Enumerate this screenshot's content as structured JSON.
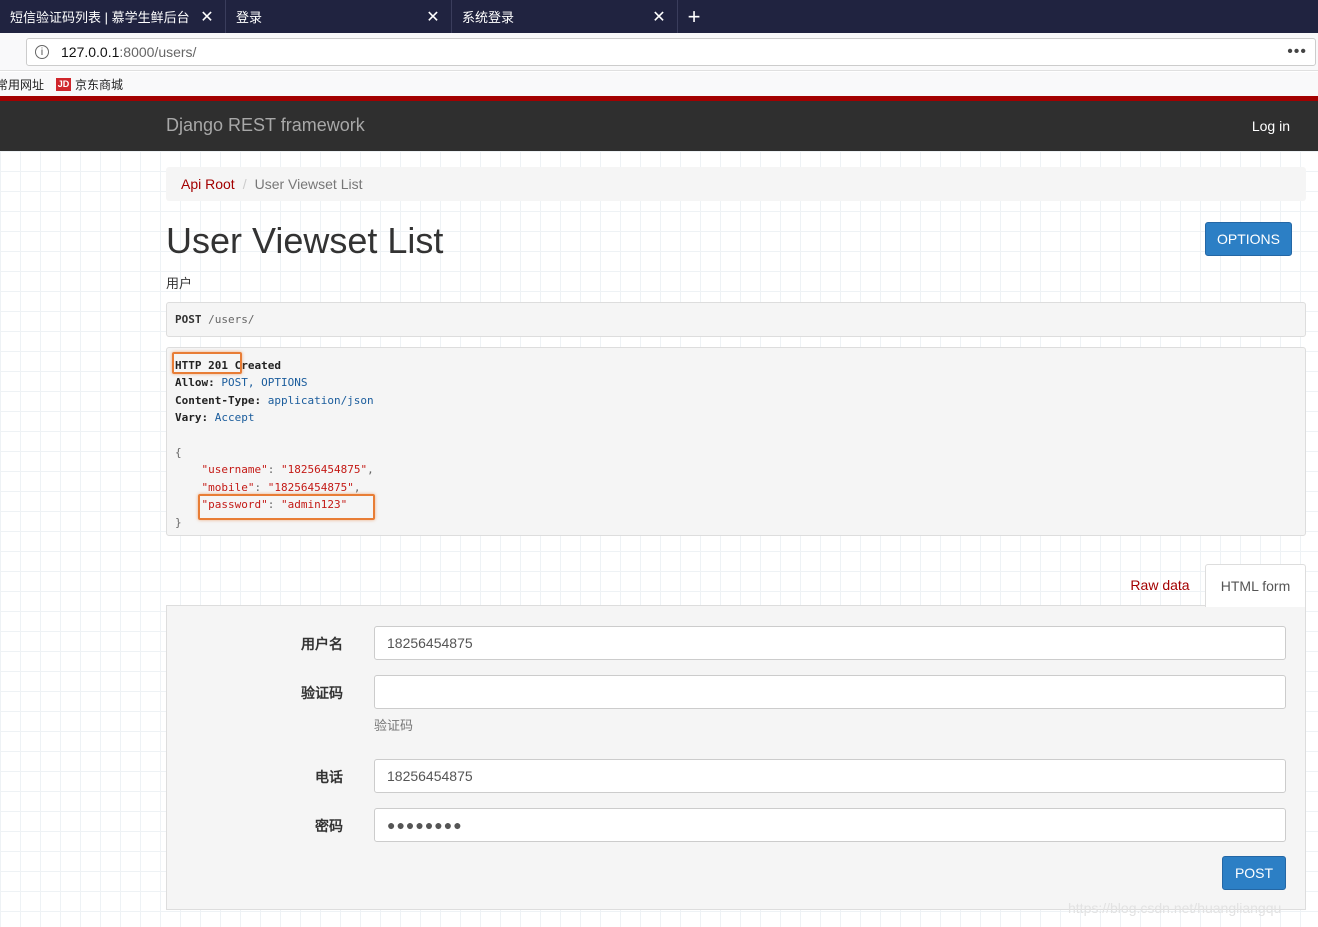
{
  "browser": {
    "tabs": [
      {
        "title": "短信验证码列表 | 慕学生鲜后台"
      },
      {
        "title": "登录"
      },
      {
        "title": "系统登录"
      }
    ],
    "tab_close_glyph": "✕",
    "new_tab_glyph": "+",
    "url_host": "127.0.0.1",
    "url_path": ":8000/users/",
    "url_menu_glyph": "•••",
    "bookmarks": [
      "常用网址",
      "京东商城"
    ],
    "jd_icon_text": "JD"
  },
  "navbar": {
    "brand": "Django REST framework",
    "login": "Log in"
  },
  "breadcrumb": {
    "root": "Api Root",
    "separator": "/",
    "current": "User Viewset List"
  },
  "page": {
    "title": "User Viewset List",
    "description": "用户",
    "options_label": "OPTIONS"
  },
  "request": {
    "method": "POST",
    "path": " /users/"
  },
  "response": {
    "status": "HTTP 201 Created",
    "headers": [
      {
        "key": "Allow:",
        "value": " POST, OPTIONS"
      },
      {
        "key": "Content-Type:",
        "value": " application/json"
      },
      {
        "key": "Vary:",
        "value": " Accept"
      }
    ],
    "json_open": "{",
    "json_close": "}",
    "json_fields": [
      {
        "key": "\"username\"",
        "value": "\"18256454875\"",
        "comma": ","
      },
      {
        "key": "\"mobile\"",
        "value": "\"18256454875\"",
        "comma": ","
      },
      {
        "key": "\"password\"",
        "value": "\"admin123\"",
        "comma": ""
      }
    ]
  },
  "form_tabs": {
    "raw": "Raw data",
    "html": "HTML form"
  },
  "form": {
    "username_label": "用户名",
    "username_value": "18256454875",
    "code_label": "验证码",
    "code_value": "",
    "code_help": "验证码",
    "mobile_label": "电话",
    "mobile_value": "18256454875",
    "password_label": "密码",
    "password_value": "●●●●●●●●",
    "submit_label": "POST"
  },
  "watermark": "https://blog.csdn.net/huangliangqu",
  "colors": {
    "accent": "#a30000",
    "primary_button": "#2c7fc5",
    "navbar": "#2f2f2f",
    "highlight": "#e87d36"
  }
}
